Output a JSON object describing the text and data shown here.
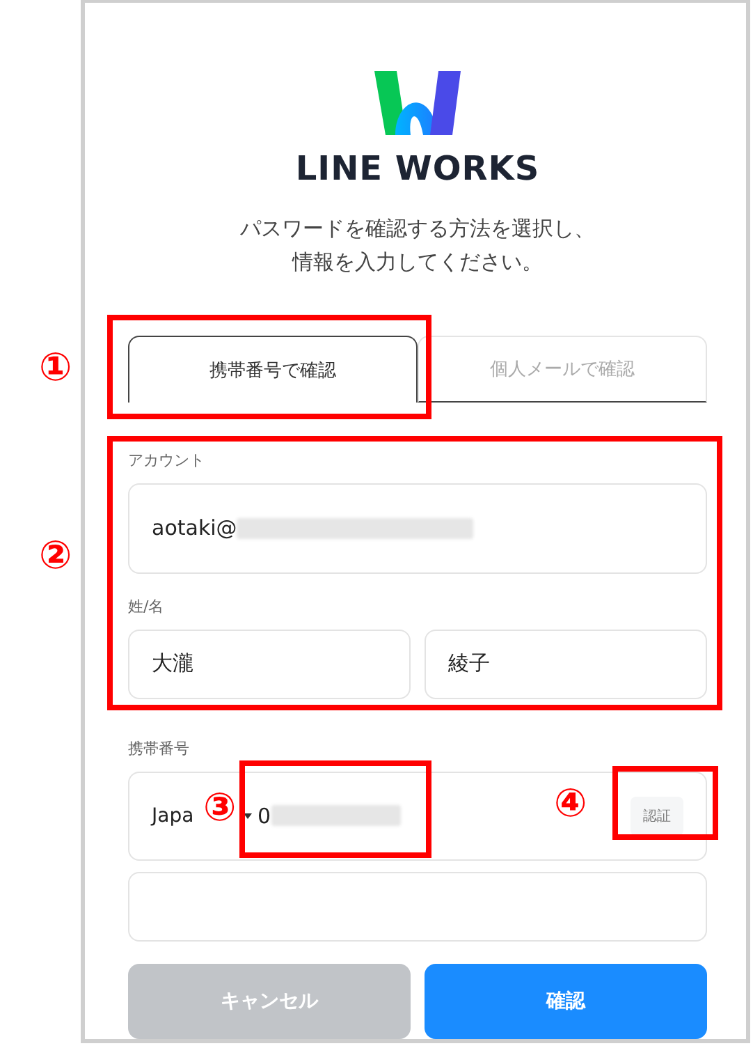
{
  "logo": {
    "wordmark": "LINE WORKS"
  },
  "instruction": [
    "パスワードを確認する方法を選択し、",
    "情報を入力してください。"
  ],
  "tabs": [
    {
      "label": "携帯番号で確認",
      "selected": true
    },
    {
      "label": "個人メールで確認",
      "selected": false
    }
  ],
  "account": {
    "label": "アカウント",
    "value": "aotaki@",
    "redacted": true
  },
  "name": {
    "label": "姓/名",
    "last_name": "大瀧",
    "first_name": "綾子"
  },
  "phone": {
    "label": "携帯番号",
    "country": "Japa",
    "value": "0",
    "redacted": true,
    "verify_button": "認証"
  },
  "buttons": [
    {
      "label": "キャンセル",
      "kind": "cancel"
    },
    {
      "label": "確認",
      "kind": "primary"
    }
  ],
  "callouts": [
    {
      "marker": "①"
    },
    {
      "marker": "②"
    },
    {
      "marker": "③"
    },
    {
      "marker": "④"
    }
  ]
}
